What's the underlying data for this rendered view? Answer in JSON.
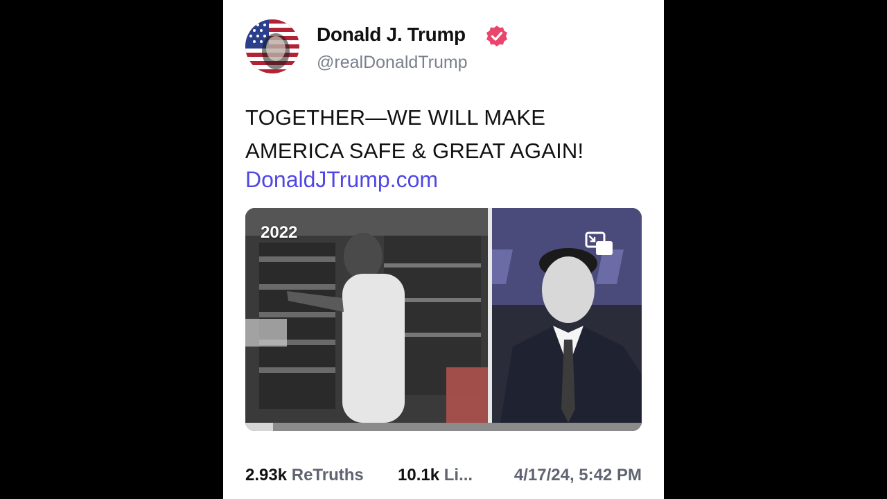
{
  "post": {
    "author": {
      "display_name": "Donald J. Trump",
      "handle": "@realDonaldTrump",
      "verified": true,
      "avatar_icon": "flag-portrait-avatar",
      "verified_icon": "verified-badge-icon"
    },
    "text_lines": [
      "TOGETHER—WE WILL MAKE",
      "AMERICA SAFE & GREAT AGAIN!"
    ],
    "link_text": "DonaldJTrump.com",
    "media": {
      "year_label": "2022",
      "pip_icon": "picture-in-picture-icon",
      "progress": 0.07
    },
    "stats": {
      "retruths_count": "2.93k",
      "retruths_label": "ReTruths",
      "likes_count": "10.1k",
      "likes_label": "Li...",
      "timestamp": "4/17/24, 5:42 PM"
    }
  },
  "colors": {
    "link": "#4f46e5",
    "verified": "#e8466b",
    "background": "#000000",
    "card": "#ffffff"
  }
}
